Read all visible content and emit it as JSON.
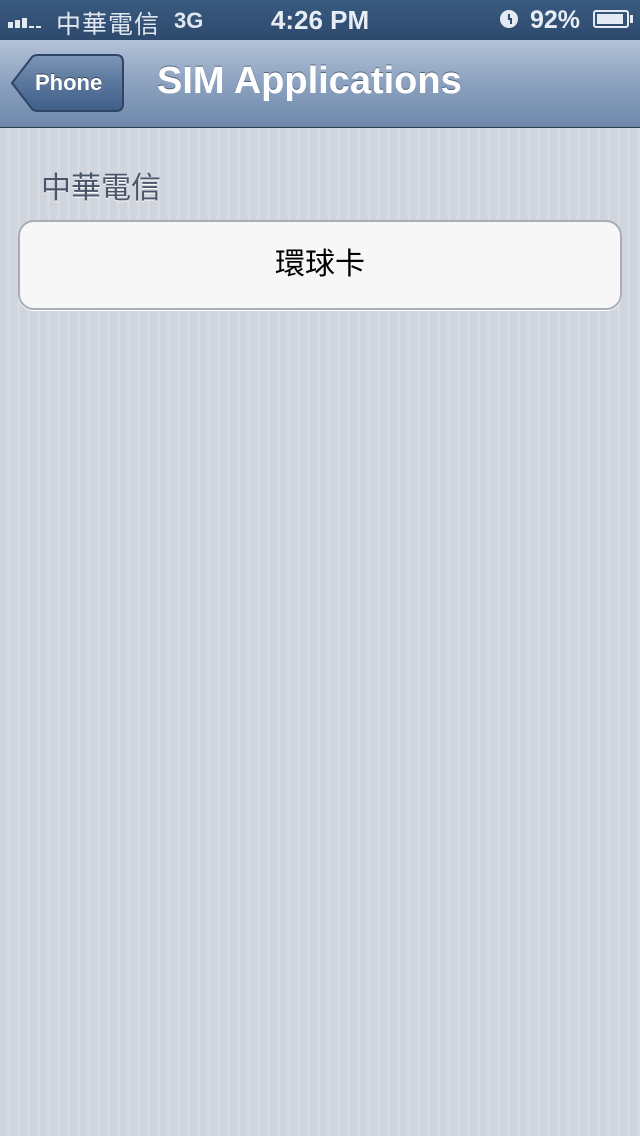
{
  "status_bar": {
    "carrier": "中華電信",
    "network": "3G",
    "time": "4:26 PM",
    "battery_percent": "92%",
    "battery_level": 0.92,
    "icons": [
      "signal-icon",
      "alarm-icon",
      "battery-icon"
    ]
  },
  "nav_bar": {
    "back_label": "Phone",
    "title": "SIM Applications"
  },
  "section": {
    "header": "中華電信",
    "items": [
      {
        "label": "環球卡"
      }
    ]
  },
  "colors": {
    "status_bar": "#2d4a6d",
    "nav_bar_top": "#b4c3d7",
    "nav_bar_bottom": "#6e88ab",
    "background": "#d1d5de",
    "cell_background": "#f7f7f7",
    "section_header_text": "#4c566a"
  }
}
